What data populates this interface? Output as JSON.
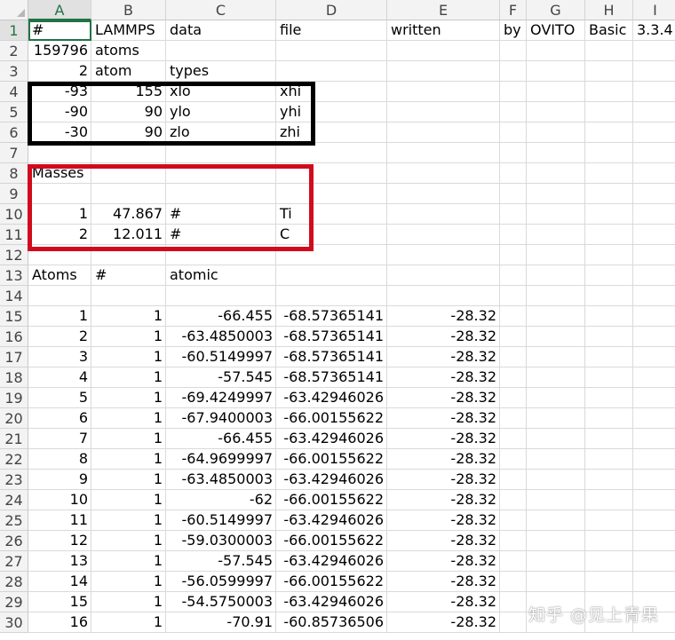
{
  "columns": [
    "A",
    "B",
    "C",
    "D",
    "E",
    "F",
    "G",
    "H",
    "I"
  ],
  "selected_column": "A",
  "selected_row": "1",
  "colors": {
    "accent": "#217346",
    "bounds_box": "#000000",
    "masses_box": "#d20a1e"
  },
  "rows": [
    {
      "n": "1",
      "cells": [
        "#",
        "LAMMPS",
        "data",
        "file",
        "written",
        "by",
        "OVITO",
        "Basic",
        "3.3.4"
      ]
    },
    {
      "n": "2",
      "cells": [
        "159796",
        "atoms",
        "",
        "",
        "",
        "",
        "",
        "",
        ""
      ]
    },
    {
      "n": "3",
      "cells": [
        "2",
        "atom",
        "types",
        "",
        "",
        "",
        "",
        "",
        ""
      ]
    },
    {
      "n": "4",
      "cells": [
        "-93",
        "155",
        "xlo",
        "xhi",
        "",
        "",
        "",
        "",
        ""
      ]
    },
    {
      "n": "5",
      "cells": [
        "-90",
        "90",
        "ylo",
        "yhi",
        "",
        "",
        "",
        "",
        ""
      ]
    },
    {
      "n": "6",
      "cells": [
        "-30",
        "90",
        "zlo",
        "zhi",
        "",
        "",
        "",
        "",
        ""
      ]
    },
    {
      "n": "7",
      "cells": [
        "",
        "",
        "",
        "",
        "",
        "",
        "",
        "",
        ""
      ]
    },
    {
      "n": "8",
      "cells": [
        "Masses",
        "",
        "",
        "",
        "",
        "",
        "",
        "",
        ""
      ]
    },
    {
      "n": "9",
      "cells": [
        "",
        "",
        "",
        "",
        "",
        "",
        "",
        "",
        ""
      ]
    },
    {
      "n": "10",
      "cells": [
        "1",
        "47.867",
        "#",
        "Ti",
        "",
        "",
        "",
        "",
        ""
      ]
    },
    {
      "n": "11",
      "cells": [
        "2",
        "12.011",
        "#",
        "C",
        "",
        "",
        "",
        "",
        ""
      ]
    },
    {
      "n": "12",
      "cells": [
        "",
        "",
        "",
        "",
        "",
        "",
        "",
        "",
        ""
      ]
    },
    {
      "n": "13",
      "cells": [
        "Atoms",
        "#",
        "atomic",
        "",
        "",
        "",
        "",
        "",
        ""
      ]
    },
    {
      "n": "14",
      "cells": [
        "",
        "",
        "",
        "",
        "",
        "",
        "",
        "",
        ""
      ]
    },
    {
      "n": "15",
      "cells": [
        "1",
        "1",
        "-66.455",
        "-68.57365141",
        "-28.32",
        "",
        "",
        "",
        ""
      ]
    },
    {
      "n": "16",
      "cells": [
        "2",
        "1",
        "-63.4850003",
        "-68.57365141",
        "-28.32",
        "",
        "",
        "",
        ""
      ]
    },
    {
      "n": "17",
      "cells": [
        "3",
        "1",
        "-60.5149997",
        "-68.57365141",
        "-28.32",
        "",
        "",
        "",
        ""
      ]
    },
    {
      "n": "18",
      "cells": [
        "4",
        "1",
        "-57.545",
        "-68.57365141",
        "-28.32",
        "",
        "",
        "",
        ""
      ]
    },
    {
      "n": "19",
      "cells": [
        "5",
        "1",
        "-69.4249997",
        "-63.42946026",
        "-28.32",
        "",
        "",
        "",
        ""
      ]
    },
    {
      "n": "20",
      "cells": [
        "6",
        "1",
        "-67.9400003",
        "-66.00155622",
        "-28.32",
        "",
        "",
        "",
        ""
      ]
    },
    {
      "n": "21",
      "cells": [
        "7",
        "1",
        "-66.455",
        "-63.42946026",
        "-28.32",
        "",
        "",
        "",
        ""
      ]
    },
    {
      "n": "22",
      "cells": [
        "8",
        "1",
        "-64.9699997",
        "-66.00155622",
        "-28.32",
        "",
        "",
        "",
        ""
      ]
    },
    {
      "n": "23",
      "cells": [
        "9",
        "1",
        "-63.4850003",
        "-63.42946026",
        "-28.32",
        "",
        "",
        "",
        ""
      ]
    },
    {
      "n": "24",
      "cells": [
        "10",
        "1",
        "-62",
        "-66.00155622",
        "-28.32",
        "",
        "",
        "",
        ""
      ]
    },
    {
      "n": "25",
      "cells": [
        "11",
        "1",
        "-60.5149997",
        "-63.42946026",
        "-28.32",
        "",
        "",
        "",
        ""
      ]
    },
    {
      "n": "26",
      "cells": [
        "12",
        "1",
        "-59.0300003",
        "-66.00155622",
        "-28.32",
        "",
        "",
        "",
        ""
      ]
    },
    {
      "n": "27",
      "cells": [
        "13",
        "1",
        "-57.545",
        "-63.42946026",
        "-28.32",
        "",
        "",
        "",
        ""
      ]
    },
    {
      "n": "28",
      "cells": [
        "14",
        "1",
        "-56.0599997",
        "-66.00155622",
        "-28.32",
        "",
        "",
        "",
        ""
      ]
    },
    {
      "n": "29",
      "cells": [
        "15",
        "1",
        "-54.5750003",
        "-63.42946026",
        "-28.32",
        "",
        "",
        "",
        ""
      ]
    },
    {
      "n": "30",
      "cells": [
        "16",
        "1",
        "-70.91",
        "-60.85736506",
        "-28.32",
        "",
        "",
        "",
        ""
      ]
    }
  ],
  "watermark": "知乎 @见上青果"
}
